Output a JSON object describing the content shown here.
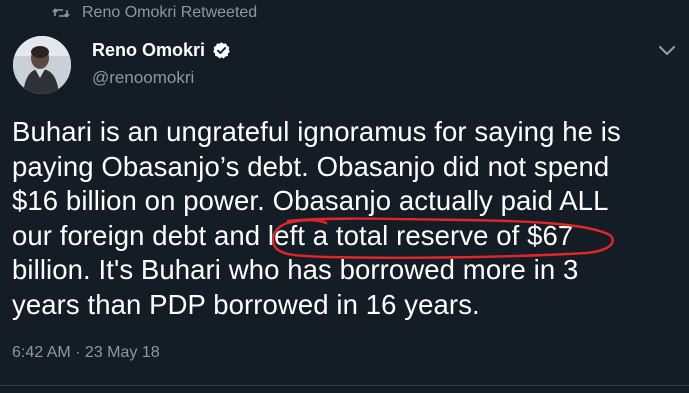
{
  "retweet": {
    "label": "Reno Omokri Retweeted",
    "icon": "retweet-icon"
  },
  "author": {
    "display_name": "Reno Omokri",
    "handle": "@renoomokri",
    "verified": true,
    "verified_icon": "verified-badge-icon"
  },
  "tweet": {
    "lines": [
      "Buhari is an ungrateful ignoramus for saying he is",
      "paying Obasanjo’s debt. Obasanjo did not spend",
      "$16 billion on power. Obasanjo actually paid ALL",
      "our foreign debt and left a total reserve of $67",
      "billion. It's Buhari who has borrowed more in 3",
      "years than PDP borrowed in 16 years."
    ],
    "highlighted_phrase": "left a total reserve of $67",
    "time": "6:42 AM · 23 May 18"
  },
  "colors": {
    "background": "#141d26",
    "text": "#ffffff",
    "secondary_text": "#8899a6",
    "annotation": "#e0262b"
  }
}
